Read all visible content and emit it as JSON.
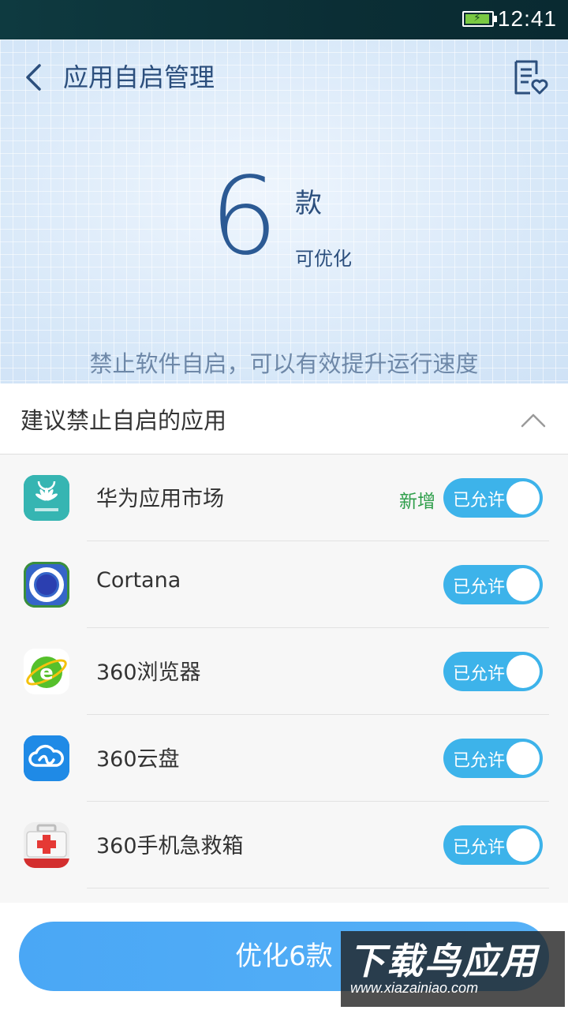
{
  "status_bar": {
    "time": "12:41",
    "battery_level": 0.95,
    "battery_color": "#7ac943"
  },
  "header": {
    "title": "应用自启管理"
  },
  "summary": {
    "count": "6",
    "unit": "款",
    "sub": "可优化",
    "description": "禁止软件自启，可以有效提升运行速度"
  },
  "section": {
    "title": "建议禁止自启的应用"
  },
  "apps": [
    {
      "name": "华为应用市场",
      "badge": "新增",
      "toggle_label": "已允许",
      "icon": "huawei-appgallery-icon"
    },
    {
      "name": "Cortana",
      "badge": "",
      "toggle_label": "已允许",
      "icon": "cortana-icon"
    },
    {
      "name": "360浏览器",
      "badge": "",
      "toggle_label": "已允许",
      "icon": "360-browser-icon"
    },
    {
      "name": "360云盘",
      "badge": "",
      "toggle_label": "已允许",
      "icon": "360-cloud-icon"
    },
    {
      "name": "360手机急救箱",
      "badge": "",
      "toggle_label": "已允许",
      "icon": "360-first-aid-icon"
    }
  ],
  "optimize_button": {
    "label": "优化6款"
  },
  "watermark": {
    "main": "下载鸟应用",
    "url": "www.xiazainiao.com"
  },
  "colors": {
    "accent": "#3db3ea",
    "button": "#4aa7f5",
    "title": "#2c4f7d",
    "badge": "#2e9e4a"
  }
}
